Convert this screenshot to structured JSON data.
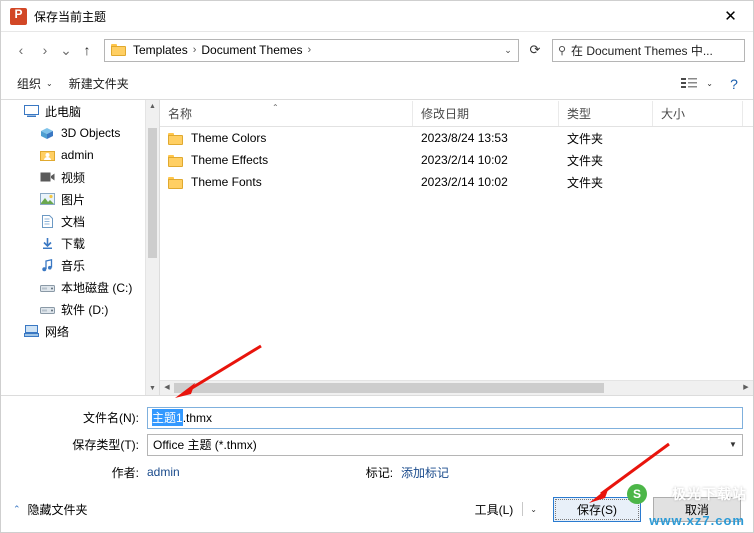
{
  "window": {
    "title": "保存当前主题",
    "app_icon": "powerpoint-icon",
    "close_label": "✕"
  },
  "nav": {
    "back": "‹",
    "forward": "›",
    "recent_caret": "⌄",
    "up": "↑",
    "refresh": "⟳",
    "breadcrumb": [
      "Templates",
      "Document Themes"
    ],
    "breadcrumb_sep": "›",
    "address_caret": "⌄",
    "search_placeholder": "在 Document Themes 中...",
    "search_icon": "search-icon"
  },
  "commandbar": {
    "organize": "组织",
    "new_folder": "新建文件夹",
    "view_icon": "view-layout-icon",
    "view_caret": "⌄",
    "help": "?"
  },
  "navpane": {
    "items": [
      {
        "label": "此电脑",
        "icon": "computer-icon",
        "level": 1
      },
      {
        "label": "3D Objects",
        "icon": "folder3d-icon",
        "level": 2
      },
      {
        "label": "admin",
        "icon": "user-folder-icon",
        "level": 2
      },
      {
        "label": "视频",
        "icon": "video-icon",
        "level": 2
      },
      {
        "label": "图片",
        "icon": "pictures-icon",
        "level": 2
      },
      {
        "label": "文档",
        "icon": "documents-icon",
        "level": 2
      },
      {
        "label": "下载",
        "icon": "downloads-icon",
        "level": 2
      },
      {
        "label": "音乐",
        "icon": "music-icon",
        "level": 2
      },
      {
        "label": "本地磁盘 (C:)",
        "icon": "drive-icon",
        "level": 2
      },
      {
        "label": "软件 (D:)",
        "icon": "drive-icon",
        "level": 2
      },
      {
        "label": "网络",
        "icon": "network-icon",
        "level": 1
      }
    ]
  },
  "filelist": {
    "columns": [
      {
        "key": "name",
        "label": "名称"
      },
      {
        "key": "date",
        "label": "修改日期"
      },
      {
        "key": "type",
        "label": "类型"
      },
      {
        "key": "size",
        "label": "大小"
      }
    ],
    "sort_arrow": "⌃",
    "rows": [
      {
        "name": "Theme Colors",
        "date": "2023/8/24 13:53",
        "type": "文件夹",
        "size": ""
      },
      {
        "name": "Theme Effects",
        "date": "2023/2/14 10:02",
        "type": "文件夹",
        "size": ""
      },
      {
        "name": "Theme Fonts",
        "date": "2023/2/14 10:02",
        "type": "文件夹",
        "size": ""
      }
    ]
  },
  "form": {
    "filename_label": "文件名(N):",
    "filename_selected": "主题1",
    "filename_rest": ".thmx",
    "filetype_label": "保存类型(T):",
    "filetype_value": "Office 主题 (*.thmx)",
    "author_label": "作者:",
    "author_value": "admin",
    "tags_label": "标记:",
    "tags_value": "添加标记"
  },
  "footer": {
    "hide_folders": "隐藏文件夹",
    "hide_chevron": "⌃",
    "tools": "工具(L)",
    "tools_caret": "⌄",
    "save": "保存(S)",
    "cancel": "取消"
  },
  "watermark": {
    "top": "极光下载站",
    "bottom": "www.xz7.com",
    "badge": "S"
  },
  "colors": {
    "accent": "#2a7bd0",
    "selection": "#3399ff",
    "annotation": "#e8140c",
    "folder": "#ffcf63"
  }
}
